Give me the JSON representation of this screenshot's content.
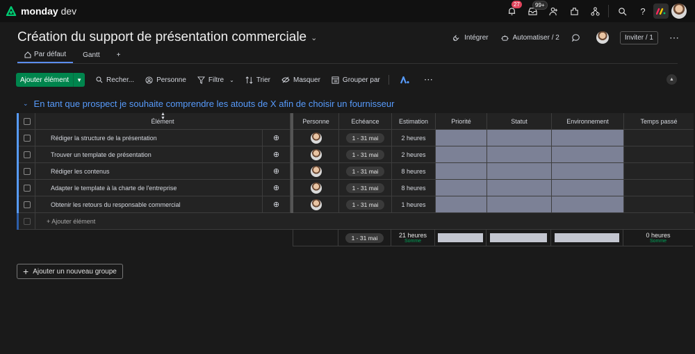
{
  "app": {
    "logo_bold": "monday",
    "logo_light": " dev"
  },
  "topbar": {
    "notifications_count": "27",
    "inbox_count": "99+",
    "icons": [
      "bell-icon",
      "inbox-icon",
      "invite-members-icon",
      "apps-icon",
      "my-work-icon",
      "search-icon",
      "help-icon",
      "products-switcher-icon",
      "user-avatar"
    ]
  },
  "board": {
    "title": "Création du support de présentation commerciale",
    "actions": {
      "integrate": "Intégrer",
      "automate": "Automatiser / 2",
      "invite": "Inviter / 1"
    }
  },
  "tabs": [
    {
      "label": "Par défaut",
      "active": true
    },
    {
      "label": "Gantt",
      "active": false
    },
    {
      "label": "+",
      "active": false
    }
  ],
  "toolbar": {
    "add_item": "Ajouter élément",
    "search": "Recher...",
    "person": "Personne",
    "filter": "Filtre",
    "sort": "Trier",
    "hide": "Masquer",
    "group_by": "Grouper par"
  },
  "group": {
    "title": "En tant que prospect je souhaite comprendre les atouts de X afin de choisir un fournisseur",
    "color": "#579bfc"
  },
  "columns": {
    "item": "Élément",
    "person": "Personne",
    "due": "Echéance",
    "estimate": "Estimation",
    "priority": "Priorité",
    "status": "Statut",
    "environment": "Environnement",
    "time_spent": "Temps passé"
  },
  "rows": [
    {
      "name": "Rédiger la structure de la présentation",
      "due": "1 - 31 mai",
      "estimate": "2 heures"
    },
    {
      "name": "Trouver un template de présentation",
      "due": "1 - 31 mai",
      "estimate": "2 heures"
    },
    {
      "name": "Rédiger les contenus",
      "due": "1 - 31 mai",
      "estimate": "8 heures"
    },
    {
      "name": "Adapter le template à la charte de l'entreprise",
      "due": "1 - 31 mai",
      "estimate": "8 heures"
    },
    {
      "name": "Obtenir les retours du responsable commercial",
      "due": "1 - 31 mai",
      "estimate": "1 heures"
    }
  ],
  "add_item_row": "+ Ajouter élément",
  "summary": {
    "due": "1 - 31 mai",
    "estimate": "21 heures",
    "estimate_label": "Somme",
    "time_spent": "0 heures",
    "time_spent_label": "Somme"
  },
  "add_group": "Ajouter un nouveau groupe"
}
